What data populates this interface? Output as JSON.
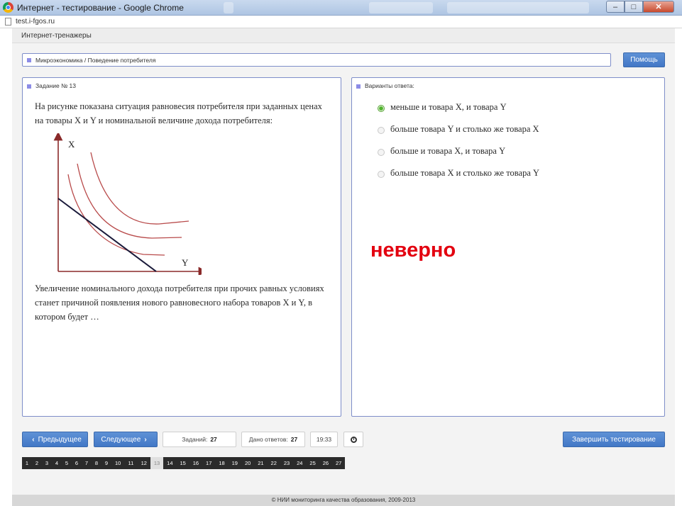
{
  "window": {
    "title": "Интернет - тестирование - Google Chrome",
    "url": "test.i-fgos.ru",
    "controls": {
      "minimize": "–",
      "maximize": "□",
      "close": "✕"
    }
  },
  "app": {
    "name": "Интернет-тренажеры",
    "breadcrumb": "Микроэкономика / Поведение потребителя",
    "help_label": "Помощь"
  },
  "task": {
    "header": "Задание № 13",
    "intro": "На рисунке показана ситуация равновесия потребителя при заданных ценах на товары X и Y и номинальной величине дохода потребителя:",
    "graph": {
      "x_axis_label": "Y",
      "y_axis_label": "X",
      "indifference_curves": 3,
      "budget_lines": 1
    },
    "outro": "Увеличение номинального дохода потребителя при прочих равных условиях станет причиной появления нового равновесного набора товаров X и Y, в котором будет …"
  },
  "answers": {
    "header": "Варианты ответа:",
    "options": [
      {
        "label": "меньше и товара X, и товара Y",
        "selected": true
      },
      {
        "label": "больше товара Y и столько же товара X",
        "selected": false
      },
      {
        "label": "больше и товара X, и товара Y",
        "selected": false
      },
      {
        "label": "больше товара X и столько же товара Y",
        "selected": false
      }
    ],
    "verdict": "неверно"
  },
  "controls": {
    "prev_label": "Предыдущее",
    "next_label": "Следующее",
    "tasks_label": "Заданий:",
    "tasks_value": "27",
    "answered_label": "Дано ответов:",
    "answered_value": "27",
    "timer": "19:33",
    "finish_label": "Завершить тестирование"
  },
  "pager": {
    "pages": [
      "1",
      "2",
      "3",
      "4",
      "5",
      "6",
      "7",
      "8",
      "9",
      "10",
      "11",
      "12",
      "13",
      "14",
      "15",
      "16",
      "17",
      "18",
      "19",
      "20",
      "21",
      "22",
      "23",
      "24",
      "25",
      "26",
      "27"
    ],
    "current": "13"
  },
  "footer": "© НИИ мониторинга качества образования, 2009-2013",
  "colors": {
    "accent_blue": "#4a7fcb",
    "panel_border": "#7e8ec9",
    "verdict_red": "#e3000f",
    "curve_red": "#b84a4a",
    "budget_line": "#1a1a3a"
  }
}
